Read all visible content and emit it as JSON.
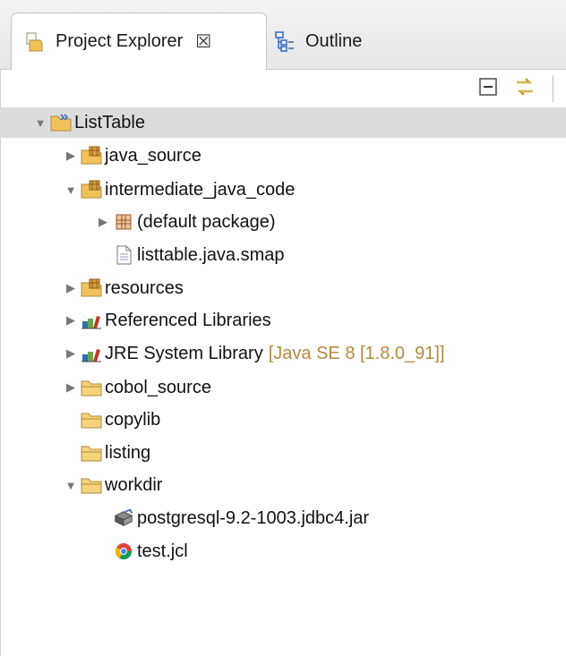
{
  "tabs": [
    {
      "label": "Project Explorer",
      "close": "☒"
    },
    {
      "label": "Outline"
    }
  ],
  "toolbar": {
    "collapse_icon": "collapse-all-icon",
    "link_icon": "link-with-editor-icon"
  },
  "tree": {
    "root": "ListTable",
    "items": [
      {
        "label": "java_source"
      },
      {
        "label": "intermediate_java_code"
      },
      {
        "label": "(default package)"
      },
      {
        "label": "listtable.java.smap"
      },
      {
        "label": "resources"
      },
      {
        "label": "Referenced Libraries"
      },
      {
        "label": "JRE System Library",
        "decoration": "[Java SE 8 [1.8.0_91]]"
      },
      {
        "label": "cobol_source"
      },
      {
        "label": "copylib"
      },
      {
        "label": "listing"
      },
      {
        "label": "workdir"
      },
      {
        "label": "postgresql-9.2-1003.jdbc4.jar"
      },
      {
        "label": "test.jcl"
      }
    ]
  },
  "colors": {
    "selection": "#dcdcdc",
    "decoration": "#b28a3e",
    "folder": "#f2c25a"
  }
}
